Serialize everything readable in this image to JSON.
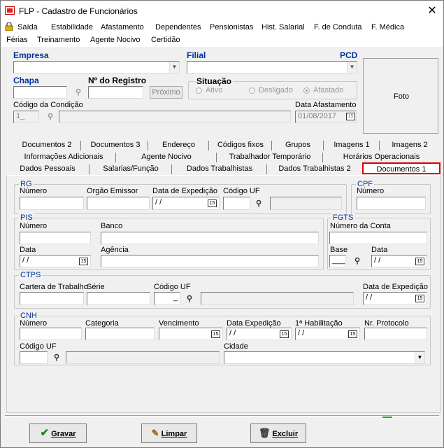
{
  "window": {
    "title": "FLP - Cadastro de Funcionários"
  },
  "menu": {
    "row1": [
      "Saída",
      "Estabilidade",
      "Afastamento",
      "Dependentes",
      "Pensionistas",
      "Hist. Salarial",
      "F. de Conduta",
      "F. Médica"
    ],
    "row2": [
      "Férias",
      "Treinamento",
      "Agente Nocivo",
      "Certidão"
    ]
  },
  "header": {
    "empresa_label": "Empresa",
    "filial_label": "Filial",
    "pcd_label": "PCD",
    "chapa_label": "Chapa",
    "registro_label": "Nº do Registro",
    "proximo_label": "Próximo",
    "situacao_label": "Situação",
    "situacao_options": [
      "Ativo",
      "Desligado",
      "Afastado"
    ],
    "codigo_condicao_label": "Código da Condição",
    "codigo_condicao_value": "1_",
    "data_afastamento_label": "Data Afastamento",
    "data_afastamento_value": "01/08/2017",
    "foto_label": "Foto"
  },
  "tabs": {
    "row1": [
      "Documentos 2",
      "Documentos 3",
      "Endereço",
      "Códigos fixos",
      "Grupos",
      "Imagens 1",
      "Imagens 2"
    ],
    "row2": [
      "Informações Adicionais",
      "Agente Nocivo",
      "Trabalhador Temporário",
      "Horários Operacionais"
    ],
    "row3": [
      "Dados Pessoais",
      "Salarias/Função",
      "Dados Trabalhistas",
      "Dados Trabalhistas 2",
      "Documentos 1"
    ]
  },
  "rg": {
    "title": "RG",
    "numero": "Número",
    "orgao": "Orgão Emissor",
    "data_exp": "Data de Expedição",
    "codigo_uf": "Código UF",
    "data_value": " / /"
  },
  "cpf": {
    "title": "CPF",
    "numero": "Número"
  },
  "pis": {
    "title": "PIS",
    "numero": "Número",
    "banco": "Banco",
    "data": "Data",
    "agencia": "Agência",
    "data_value": " / /"
  },
  "fgts": {
    "title": "FGTS",
    "numero_conta": "Número da Conta",
    "base": "Base",
    "data": "Data",
    "base_value": "___",
    "data_value": " / /"
  },
  "ctps": {
    "title": "CTPS",
    "carteira": "Cartera de Trabalho",
    "serie": "Série",
    "codigo_uf": "Código UF",
    "uf_value": "_",
    "data_exp": "Data de Expedição",
    "data_value": " / /"
  },
  "cnh": {
    "title": "CNH",
    "numero": "Número",
    "categoria": "Categoria",
    "vencimento": "Vencimento",
    "data_exp": "Data Expedição",
    "habilitacao": "1ª Habilitação",
    "protocolo": "Nr. Protocolo",
    "codigo_uf": "Código UF",
    "cidade": "Cidade",
    "data_exp_value": " / /",
    "hab_value": " / /"
  },
  "footer": {
    "gravar": "Gravar",
    "limpar": "Limpar",
    "excluir": "Excluir"
  },
  "colors": {
    "accent": "#003399",
    "highlight": "#dd0000"
  }
}
